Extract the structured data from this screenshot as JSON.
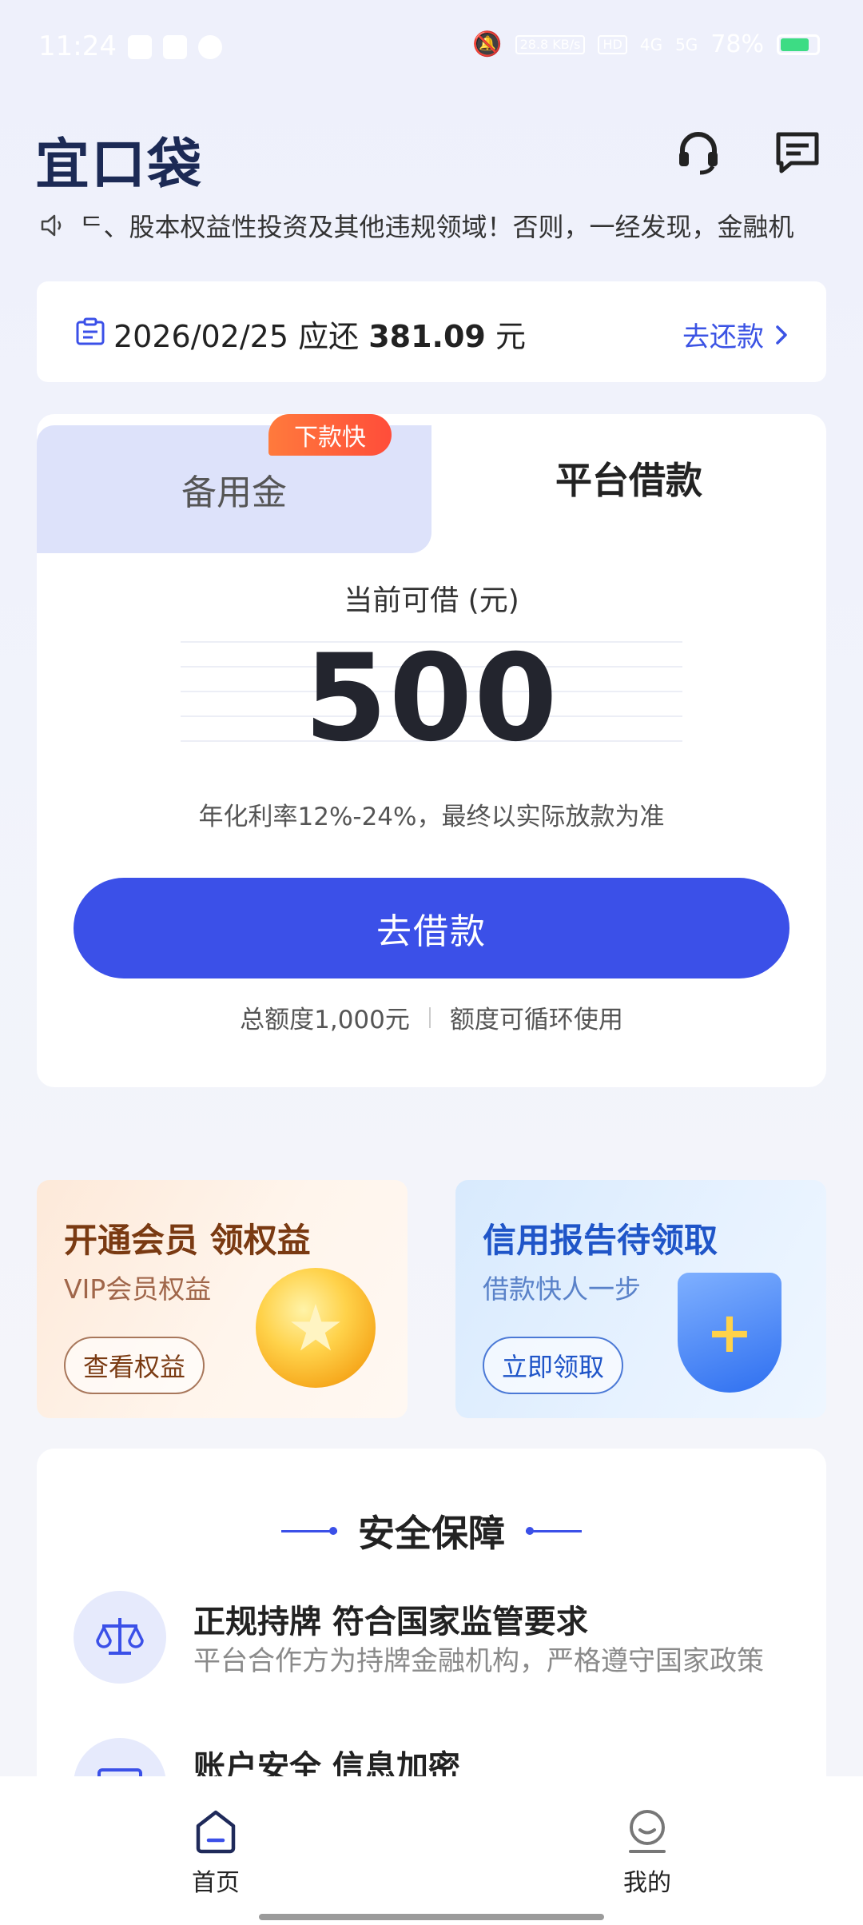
{
  "status_bar": {
    "time": "11:24",
    "net_speed": "28.8 KB/s",
    "hd": "HD",
    "net1": "4G",
    "net2": "5G",
    "battery": "78%"
  },
  "header": {
    "logo": "宜口袋",
    "service_icon": "headset-icon",
    "message_icon": "message-icon"
  },
  "notice": {
    "icon": "speaker-icon",
    "text": "ᄃ、股本权益性投资及其他违规领域！否则，一经发现，金融机"
  },
  "repay": {
    "date": "2026/02/25",
    "due_label": "应还",
    "amount": "381.09",
    "unit": "元",
    "action": "去还款"
  },
  "loan_card": {
    "tabs": [
      {
        "label": "备用金",
        "badge": "下款快",
        "active": false
      },
      {
        "label": "平台借款",
        "active": true
      }
    ],
    "available_label": "当前可借 (元)",
    "amount": "500",
    "rate_note": "年化利率12%-24%，最终以实际放款为准",
    "button": "去借款",
    "total_quota": "总额度1,000元",
    "cycle_note": "额度可循环使用"
  },
  "promos": {
    "vip": {
      "title": "开通会员 领权益",
      "subtitle": "VIP会员权益",
      "button": "查看权益"
    },
    "credit": {
      "title": "信用报告待领取",
      "subtitle": "借款快人一步",
      "button": "立即领取"
    }
  },
  "security": {
    "title": "安全保障",
    "items": [
      {
        "title": "正规持牌 符合国家监管要求",
        "desc": "平台合作方为持牌金融机构，严格遵守国家政策",
        "icon": "scale-icon"
      },
      {
        "title": "账户安全 信息加密",
        "desc": "",
        "icon": "card-icon"
      }
    ]
  },
  "nav": {
    "items": [
      {
        "label": "首页",
        "icon": "home-icon",
        "active": true
      },
      {
        "label": "我的",
        "icon": "profile-icon",
        "active": false
      }
    ]
  },
  "colors": {
    "primary": "#3b50e8",
    "badge": "#ff5a3a",
    "tab_inactive_bg": "#dde2fa"
  }
}
